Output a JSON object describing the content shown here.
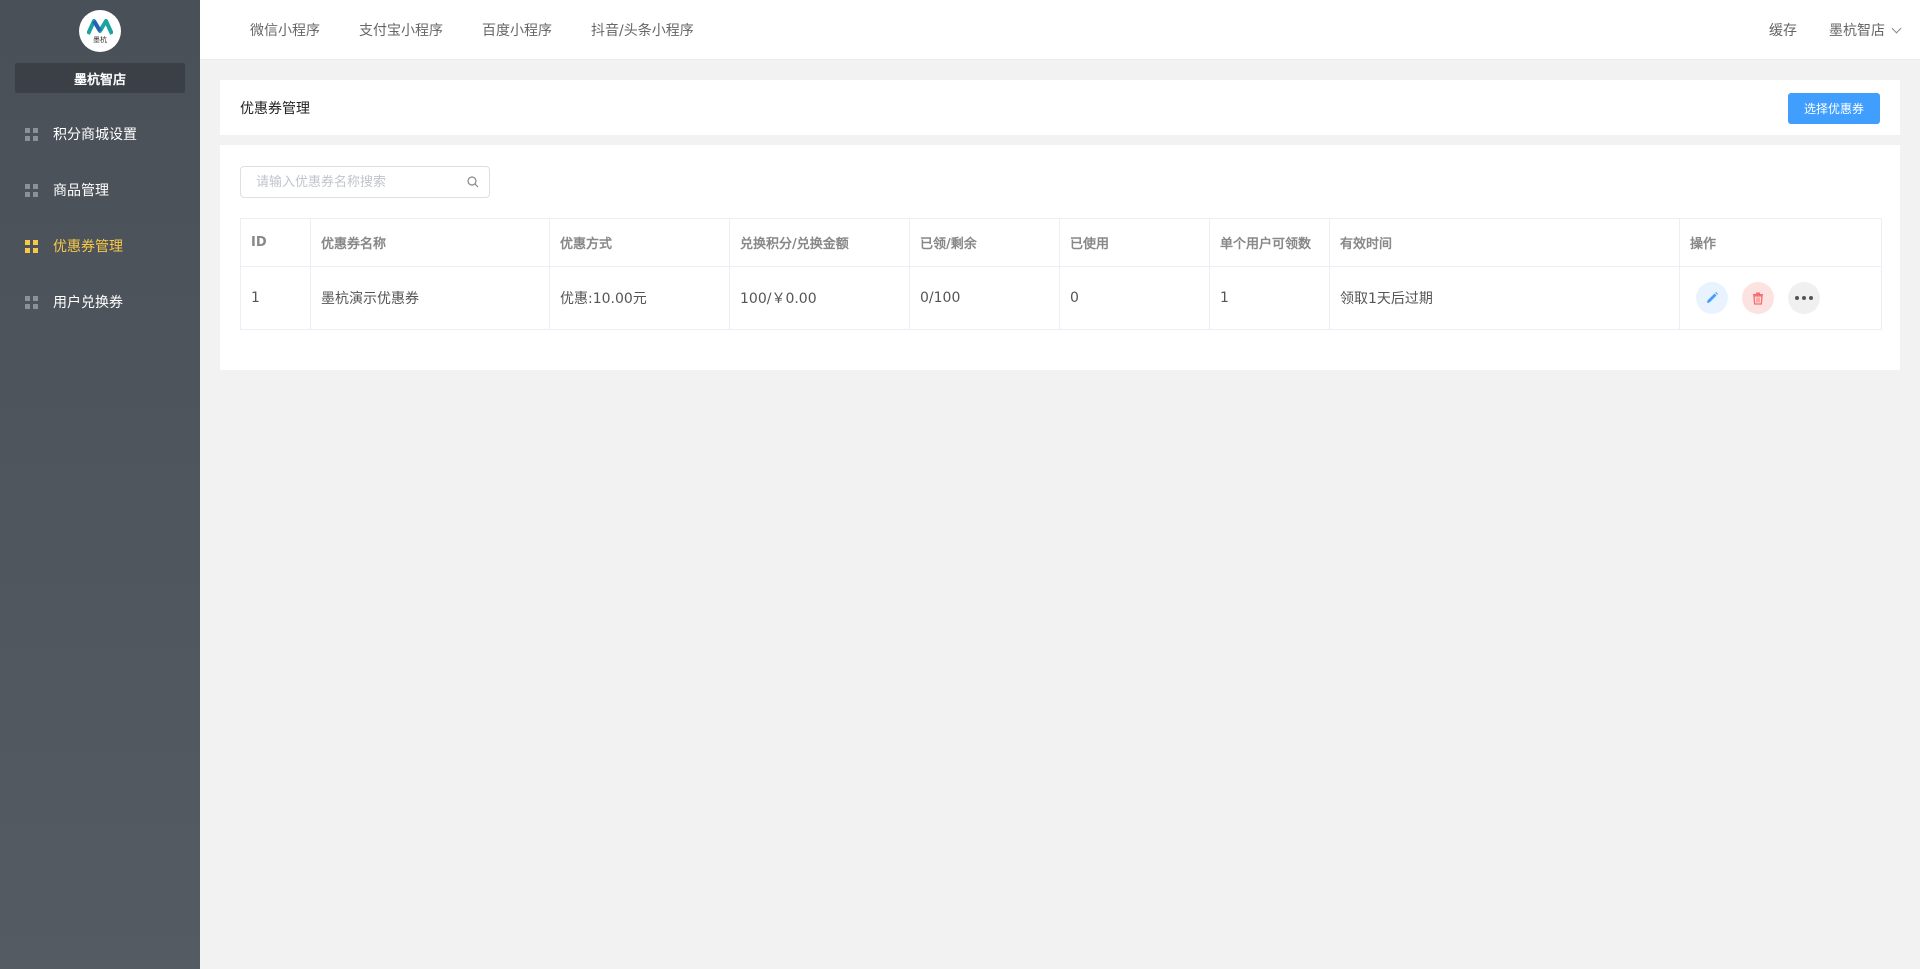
{
  "app": {
    "logo_text": "墨杭",
    "shop_name": "墨杭智店"
  },
  "sidebar": {
    "items": [
      {
        "label": "积分商城设置",
        "icon": "grid-icon",
        "active": false
      },
      {
        "label": "商品管理",
        "icon": "grid-icon",
        "active": false
      },
      {
        "label": "优惠券管理",
        "icon": "grid-icon",
        "active": true
      },
      {
        "label": "用户兑换券",
        "icon": "grid-icon",
        "active": false
      }
    ]
  },
  "topbar": {
    "tabs": [
      "微信小程序",
      "支付宝小程序",
      "百度小程序",
      "抖音/头条小程序"
    ],
    "cache_label": "缓存",
    "user_label": "墨杭智店"
  },
  "page": {
    "title": "优惠券管理",
    "select_button": "选择优惠券",
    "search_placeholder": "请输入优惠券名称搜索"
  },
  "table": {
    "headers": [
      "ID",
      "优惠券名称",
      "优惠方式",
      "兑换积分/兑换金额",
      "已领/剩余",
      "已使用",
      "单个用户可领数",
      "有效时间",
      "操作"
    ],
    "rows": [
      {
        "id": "1",
        "name": "墨杭演示优惠券",
        "discount": "优惠:10.00元",
        "exchange": "100/￥0.00",
        "received": "0/100",
        "used": "0",
        "per_user": "1",
        "valid": "领取1天后过期"
      }
    ]
  },
  "colors": {
    "accent": "#409eff",
    "active_menu": "#f7c948",
    "danger": "#f56c6c"
  }
}
